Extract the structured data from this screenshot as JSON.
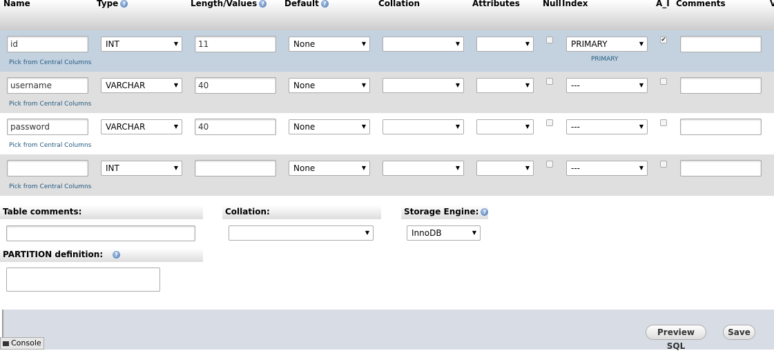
{
  "header": {
    "name": "Name",
    "type": "Type",
    "length": "Length/Values",
    "default": "Default",
    "collation": "Collation",
    "attributes": "Attributes",
    "null": "Null",
    "index": "Index",
    "ai": "A_I",
    "comments": "Comments",
    "cut": "V"
  },
  "pick_label": "Pick from Central Columns",
  "rows": [
    {
      "name": "id",
      "type": "INT",
      "length": "11",
      "default": "None",
      "collation": "",
      "attributes": "",
      "null": false,
      "index": "PRIMARY",
      "index_label": "PRIMARY",
      "ai": true,
      "comments": ""
    },
    {
      "name": "username",
      "type": "VARCHAR",
      "length": "40",
      "default": "None",
      "collation": "",
      "attributes": "",
      "null": false,
      "index": "---",
      "ai": false,
      "comments": ""
    },
    {
      "name": "password",
      "type": "VARCHAR",
      "length": "40",
      "default": "None",
      "collation": "",
      "attributes": "",
      "null": false,
      "index": "---",
      "ai": false,
      "comments": ""
    },
    {
      "name": "",
      "type": "INT",
      "length": "",
      "default": "None",
      "collation": "",
      "attributes": "",
      "null": false,
      "index": "---",
      "ai": false,
      "comments": ""
    }
  ],
  "table_options": {
    "table_comments_label": "Table comments:",
    "collation_label": "Collation:",
    "storage_engine_label": "Storage Engine:",
    "storage_engine_value": "InnoDB",
    "partition_label": "PARTITION definition:"
  },
  "footer": {
    "preview_sql": "Preview SQL",
    "save": "Save",
    "console": "Console"
  },
  "icons": {
    "help": "help-icon",
    "checkbox": "checkbox",
    "dropdown": "chevron-down-icon",
    "console": "console-icon"
  },
  "colors": {
    "primary_row": "#c4d2e0",
    "alt_row": "#dfdfdf",
    "link": "#235a81"
  }
}
